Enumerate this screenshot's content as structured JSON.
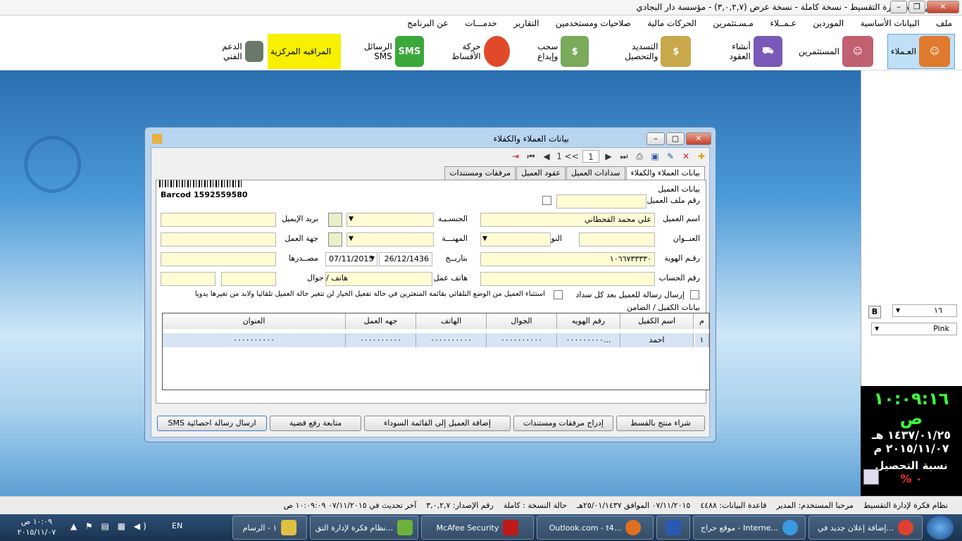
{
  "window": {
    "title": "نظام فكرة لإدارة التقسيط - نسخة كاملة - نسخة عرض (٣,٠,٢,٧) - مؤسسة دار البجادي"
  },
  "menu": [
    "ملف",
    "البيانات الأساسية",
    "الموردين",
    "عـمــلاء",
    "مـسـتثمرين",
    "الحركات مالية",
    "صلاحيات ومستخدمين",
    "التقارير",
    "خدمـــات",
    "عن البرنامج"
  ],
  "toolbar": [
    {
      "label": "العـملاء",
      "icon": "customers-icon",
      "color": "#e07a2e"
    },
    {
      "label": "المستثمرين",
      "icon": "investors-icon",
      "color": "#c06070"
    },
    {
      "label": "أنشاء العقود",
      "icon": "contracts-cart-icon",
      "color": "#7a5ab8"
    },
    {
      "label": "التسديد والتحصيل",
      "icon": "payment-icon",
      "color": "#c8a84a"
    },
    {
      "label": "سحب وإيداع",
      "icon": "money-icon",
      "color": "#7aaa5a"
    },
    {
      "label": "حركة الأقساط",
      "icon": "pie-chart-icon",
      "color": "#e04a2a"
    },
    {
      "label": "الرسائل SMS",
      "icon": "sms-icon",
      "color": "#3aa83a"
    },
    {
      "label": "المراقبه المركزية",
      "icon": "monitor-icon",
      "color": "#7a8ab0"
    },
    {
      "label": "الدعم الفني",
      "icon": "support-icon",
      "color": "#6a7a6a"
    }
  ],
  "dialog": {
    "title": "بيانات العملاء والكفلاء",
    "nav": {
      "record": "1",
      "of": "1 <<"
    },
    "tabs": [
      "بيانات العملاء والكفلاء",
      "سدادات العميل",
      "عقود العميل",
      "مرفقات ومستندات"
    ],
    "section_customer": "بيانات العميل",
    "barcode": "Barcod 1592559580",
    "labels": {
      "file_no": "رقم ملف العميل",
      "name": "اسم العميل",
      "nationality": "الجنسـيـة",
      "email": "بريد الإيميل",
      "address": "العنــوان",
      "gender": "النوع",
      "job": "المهنـــة",
      "employer": "جهة العمل",
      "id_no": "رقـم الهوية",
      "date": "بتاريــخ",
      "source": "مصــدرها",
      "account": "رقم الحساب",
      "work_phone": "هاتف عمل",
      "phone_mobile": "هاتف / جوال",
      "sms_option": "إرسال رسالة للعميل بعد كل سداد",
      "exclude_option": "استثناء العميل من الوضع التلقائي بقائمة المتعثرين في حالة تفعيل الخيار لن تتغير حالة العميل تلقائيا ولابد من تغيرها يدويا"
    },
    "values": {
      "name": "علي محمد القحطاني",
      "id_no": "١٠٦٦٧٣٣٣٣٠",
      "date_hijri": "26/12/1436",
      "date_greg": "07/11/2015"
    },
    "section_guarantor": "بيانات الكفيل / الضامن",
    "grid": {
      "columns": [
        "م",
        "اسم الكفيل",
        "رقم الهويه",
        "الجوال",
        "الهاتف",
        "جهه العمل",
        "العنوان"
      ],
      "rows": [
        [
          "١",
          "احمد",
          "٠٠٠٠٠٠٠٠٠...",
          "٠٠٠٠٠٠٠٠٠٠",
          "٠٠٠٠٠٠٠٠٠٠",
          "٠٠٠٠٠٠٠٠٠٠",
          "٠٠٠٠٠٠٠٠٠٠"
        ]
      ]
    },
    "buttons": [
      "شراء منتج بالقسط",
      "إدراج مرفقات ومستندات",
      "إضافة العميل إلى القائمة السوداء",
      "متابعة رفع قضية",
      "ارسال رسالة احصائية SMS"
    ]
  },
  "rpanel": {
    "bold_btn": "B",
    "size": "١٦",
    "color": "Pink"
  },
  "clock": {
    "time": "١٠:٠٩:١٦ ص",
    "hijri": "١٤٣٧/٠١/٢٥ هـ",
    "greg": "٢٠١٥/١١/٠٧ م",
    "rate_label": "نسبة التحصيل",
    "rate": "٠ %"
  },
  "status": [
    "نظام فكرة لإدارة التقسيط",
    "مرحبا المستخدم: المدير",
    "قاعدة البيانات: ٤٤٨٨",
    "٠٧/١١/٢٠١٥ الموافق ٢٥/٠١/١٤٣٧هـ",
    "حالة النسخة : كاملة",
    "رقم الإصدار: ٣,٠,٢,٧",
    "آخر تحديث في ٠٧/١١/٢٠١٥ ١٠:٠٩:٠٩ ص"
  ],
  "taskbar": {
    "tasks": [
      "إضافة إعلان جديد في...",
      "موقع حراج - Interne...",
      "",
      "Outlook.com - t4...",
      "McAfee Security",
      "نظام فكرة لإدارة التق...",
      "١ - الرسام"
    ],
    "lang": "EN",
    "time": "١٠:٠٩ ص",
    "date": "٢٠١٥/١١/٠٧"
  }
}
